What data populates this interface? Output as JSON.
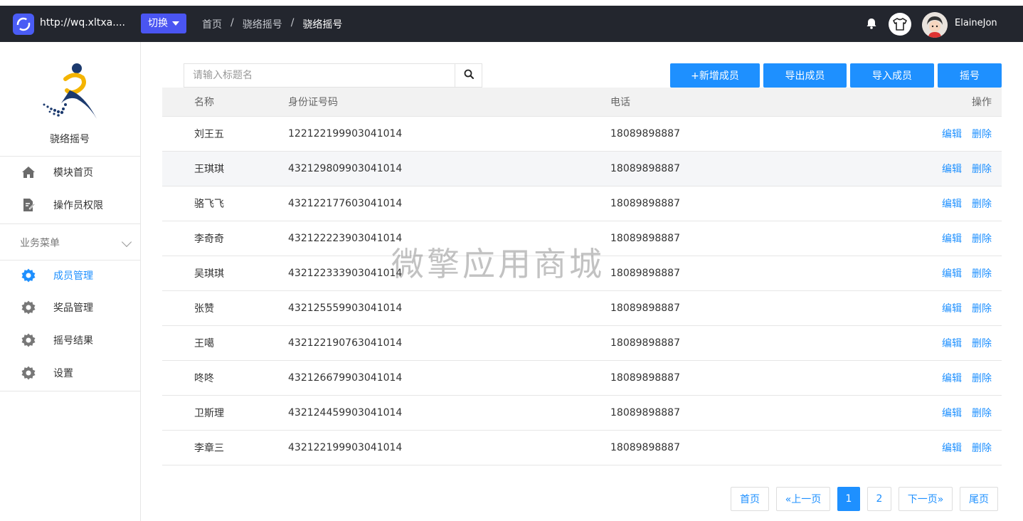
{
  "topbar": {
    "site_url": "http://wq.xltxa....",
    "switch_label": "切换",
    "breadcrumb": [
      "首页",
      "/",
      "骁络摇号",
      "/",
      "骁络摇号"
    ],
    "username": "ElaineJon"
  },
  "sidebar": {
    "brand_name": "骁络摇号",
    "items_top": [
      {
        "label": "模块首页",
        "icon": "home-icon"
      },
      {
        "label": "操作员权限",
        "icon": "edit-doc-icon"
      }
    ],
    "section_title": "业务菜单",
    "items": [
      {
        "label": "成员管理",
        "icon": "gear-icon",
        "active": true
      },
      {
        "label": "奖品管理",
        "icon": "gear-icon"
      },
      {
        "label": "摇号结果",
        "icon": "gear-icon"
      },
      {
        "label": "设置",
        "icon": "gear-icon"
      }
    ]
  },
  "search": {
    "placeholder": "请输入标题名"
  },
  "actions": [
    "+新增成员",
    "导出成员",
    "导入成员",
    "摇号"
  ],
  "table": {
    "headers": [
      "名称",
      "身份证号码",
      "电话",
      "操作"
    ],
    "op_edit": "编辑",
    "op_delete": "删除",
    "rows": [
      {
        "name": "刘王五",
        "id": "122122199903041014",
        "tel": "18089898887"
      },
      {
        "name": "王琪琪",
        "id": "432129809903041014",
        "tel": "18089898887"
      },
      {
        "name": "骆飞飞",
        "id": "432122177603041014",
        "tel": "18089898887"
      },
      {
        "name": "李奇奇",
        "id": "432122223903041014",
        "tel": "18089898887"
      },
      {
        "name": "吴琪琪",
        "id": "432122333903041014",
        "tel": "18089898887"
      },
      {
        "name": "张赞",
        "id": "432125559903041014",
        "tel": "18089898887"
      },
      {
        "name": "王噶",
        "id": "432122190763041014",
        "tel": "18089898887"
      },
      {
        "name": "咚咚",
        "id": "432126679903041014",
        "tel": "18089898887"
      },
      {
        "name": "卫斯理",
        "id": "432124459903041014",
        "tel": "18089898887"
      },
      {
        "name": "李章三",
        "id": "432122199903041014",
        "tel": "18089898887"
      }
    ]
  },
  "watermark": "微擎应用商城",
  "pagination": {
    "first": "首页",
    "prev": "«上一页",
    "pages": [
      "1",
      "2"
    ],
    "current": "1",
    "next": "下一页»",
    "last": "尾页"
  },
  "colors": {
    "accent": "#1e90ff",
    "topbar": "#23262e",
    "switch": "#4a55f2"
  }
}
